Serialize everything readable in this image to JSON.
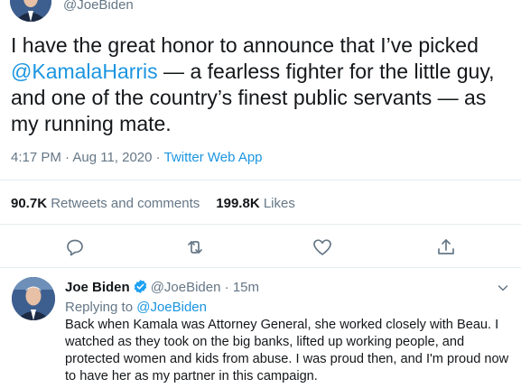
{
  "tweet": {
    "author_handle": "@JoeBiden",
    "text_before": "I have the great honor to announce that I’ve picked ",
    "mention": "@KamalaHarris",
    "text_after": " — a fearless fighter for the little guy, and one of the country’s finest public servants — as my running mate.",
    "time_date": "4:17 PM · Aug 11, 2020 · ",
    "source": "Twitter Web App",
    "retweets_count": "90.7K",
    "retweets_label": "Retweets and comments",
    "likes_count": "199.8K",
    "likes_label": "Likes"
  },
  "actions": {
    "reply_icon": "speech-bubble-icon",
    "retweet_icon": "retweet-icon",
    "like_icon": "heart-icon",
    "share_icon": "share-icon"
  },
  "reply": {
    "name": "Joe Biden",
    "handle": "@JoeBiden",
    "dot": "·",
    "time": "15m",
    "replying_prefix": "Replying to ",
    "replying_handle": "@JoeBiden",
    "text": "Back when Kamala was Attorney General, she worked closely with Beau. I watched as they took on the big banks, lifted up working people, and protected women and kids from abuse. I was proud then, and I'm proud now to have her as my partner in this campaign."
  },
  "colors": {
    "link": "#1b95e0",
    "muted": "#657786",
    "text": "#14171a",
    "divider": "#e6ecf0"
  }
}
